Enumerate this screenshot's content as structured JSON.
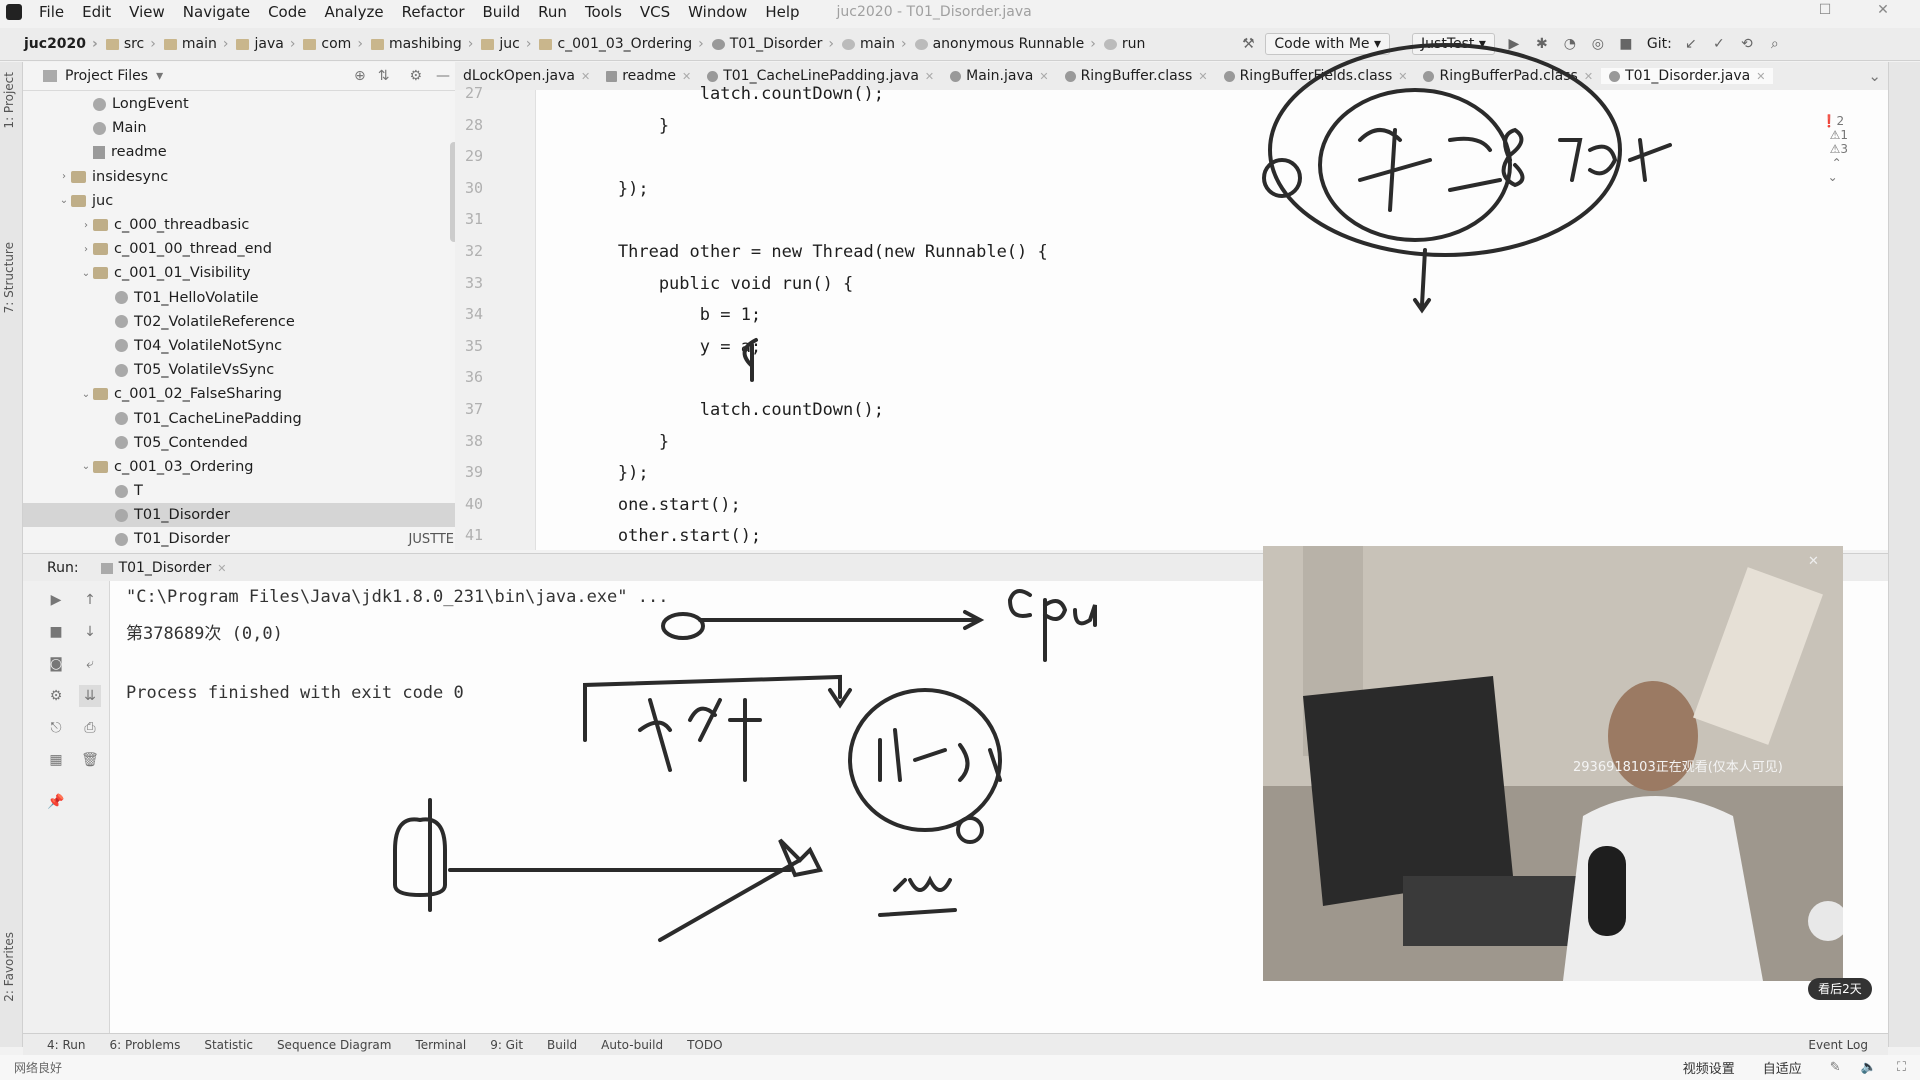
{
  "menu": {
    "items": [
      "File",
      "Edit",
      "View",
      "Navigate",
      "Code",
      "Analyze",
      "Refactor",
      "Build",
      "Run",
      "Tools",
      "VCS",
      "Window",
      "Help"
    ],
    "title": "juc2020 - T01_Disorder.java"
  },
  "breadcrumb": [
    "juc2020",
    "src",
    "main",
    "java",
    "com",
    "mashibing",
    "juc",
    "c_001_03_Ordering",
    "T01_Disorder",
    "main",
    "anonymous Runnable",
    "run"
  ],
  "toolbar": {
    "code_with_me": "Code with Me",
    "run_config": "JustTest",
    "git_label": "Git:"
  },
  "project": {
    "header": "Project Files",
    "nodes": [
      {
        "label": "LongEvent",
        "kind": "class",
        "depth": 3
      },
      {
        "label": "Main",
        "kind": "class",
        "depth": 3
      },
      {
        "label": "readme",
        "kind": "file",
        "depth": 3
      },
      {
        "label": "insidesync",
        "kind": "folder",
        "depth": 2,
        "arrow": "›"
      },
      {
        "label": "juc",
        "kind": "folder",
        "depth": 2,
        "arrow": "⌄"
      },
      {
        "label": "c_000_threadbasic",
        "kind": "folder",
        "depth": 3,
        "arrow": "›"
      },
      {
        "label": "c_001_00_thread_end",
        "kind": "folder",
        "depth": 3,
        "arrow": "›"
      },
      {
        "label": "c_001_01_Visibility",
        "kind": "folder",
        "depth": 3,
        "arrow": "⌄"
      },
      {
        "label": "T01_HelloVolatile",
        "kind": "class",
        "depth": 4
      },
      {
        "label": "T02_VolatileReference",
        "kind": "class",
        "depth": 4
      },
      {
        "label": "T04_VolatileNotSync",
        "kind": "class",
        "depth": 4
      },
      {
        "label": "T05_VolatileVsSync",
        "kind": "class",
        "depth": 4
      },
      {
        "label": "c_001_02_FalseSharing",
        "kind": "folder",
        "depth": 3,
        "arrow": "⌄"
      },
      {
        "label": "T01_CacheLinePadding",
        "kind": "class",
        "depth": 4
      },
      {
        "label": "T05_Contended",
        "kind": "class",
        "depth": 4
      },
      {
        "label": "c_001_03_Ordering",
        "kind": "folder",
        "depth": 3,
        "arrow": "⌄"
      },
      {
        "label": "T",
        "kind": "class",
        "depth": 4
      },
      {
        "label": "T01_Disorder",
        "kind": "class",
        "depth": 4,
        "selected": true
      },
      {
        "label": "T01_Disorder",
        "kind": "class",
        "depth": 4,
        "suffix": "JUSTTE"
      }
    ]
  },
  "tabs": [
    "dLockOpen.java",
    "readme",
    "T01_CacheLinePadding.java",
    "Main.java",
    "RingBuffer.class",
    "RingBufferFields.class",
    "RingBufferPad.class",
    "T01_Disorder.java"
  ],
  "inspections": {
    "errors": "2",
    "warnings": "1",
    "weak": "3"
  },
  "editor": {
    "lines": [
      {
        "n": "27",
        "text": "                latch.countDown();"
      },
      {
        "n": "28",
        "text": "            }"
      },
      {
        "n": "29",
        "text": ""
      },
      {
        "n": "30",
        "text": "        });"
      },
      {
        "n": "31",
        "text": ""
      },
      {
        "n": "32",
        "text": "        Thread other = new Thread(new Runnable() {"
      },
      {
        "n": "33",
        "text": "            public void run() {"
      },
      {
        "n": "34",
        "text": "                b = 1;"
      },
      {
        "n": "35",
        "text": "                y = a;"
      },
      {
        "n": "36",
        "text": ""
      },
      {
        "n": "37",
        "text": "                latch.countDown();"
      },
      {
        "n": "38",
        "text": "            }"
      },
      {
        "n": "39",
        "text": "        });"
      },
      {
        "n": "40",
        "text": "        one.start();"
      },
      {
        "n": "41",
        "text": "        other.start();"
      }
    ]
  },
  "run": {
    "label": "Run:",
    "tab": "T01_Disorder",
    "console": [
      "\"C:\\Program Files\\Java\\jdk1.8.0_231\\bin\\java.exe\" ...",
      "第378689次 (0,0)",
      "",
      "Process finished with exit code 0"
    ]
  },
  "bottom_tools": [
    "4: Run",
    "6: Problems",
    "Statistic",
    "Sequence Diagram",
    "Terminal",
    "9: Git",
    "Build",
    "Auto-build",
    "TODO",
    "Event Log"
  ],
  "status": {
    "left": "网络良好",
    "video_settings": "视频设置",
    "fit": "自适应"
  },
  "webcam": {
    "watermark": "2936918103正在观看(仅本人可见)",
    "badge": "看后2天"
  },
  "left_strip": [
    "1: Project",
    "7: Structure",
    "2: Favorites"
  ]
}
